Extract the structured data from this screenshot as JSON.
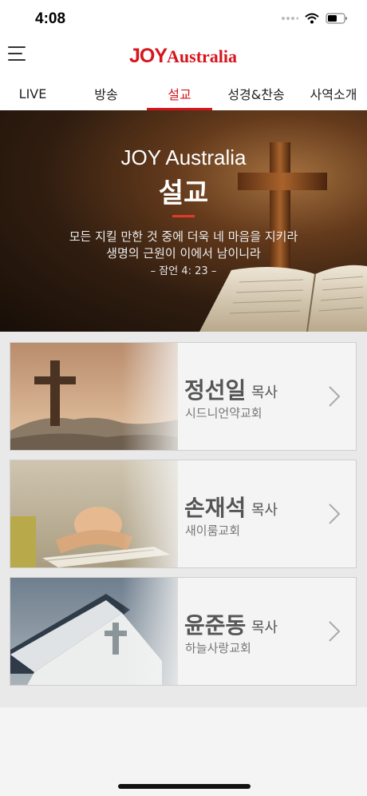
{
  "status": {
    "time": "4:08"
  },
  "header": {
    "logo_joy": "JOY",
    "logo_australia": "Australia"
  },
  "tabs": [
    {
      "label": "LIVE",
      "active": false
    },
    {
      "label": "방송",
      "active": false
    },
    {
      "label": "설교",
      "active": true
    },
    {
      "label": "성경&찬송",
      "active": false
    },
    {
      "label": "사역소개",
      "active": false
    }
  ],
  "hero": {
    "title": "JOY Australia",
    "subtitle": "설교",
    "verse_line1": "모든 지킬 만한 것 중에 더욱 네 마음을 지키라",
    "verse_line2": "생명의 근원이 이에서 남이니라",
    "reference": "– 잠언 4: 23 –"
  },
  "pastors": [
    {
      "name": "정선일",
      "title": "목사",
      "church": "시드니언약교회",
      "image": "cross-on-rock"
    },
    {
      "name": "손재석",
      "title": "목사",
      "church": "새이룸교회",
      "image": "praying-hands-on-bible"
    },
    {
      "name": "윤준동",
      "title": "목사",
      "church": "하늘사랑교회",
      "image": "bible-with-cross-shadow"
    }
  ],
  "colors": {
    "accent": "#d7151d",
    "hero_dark": "#2a1a0e"
  }
}
